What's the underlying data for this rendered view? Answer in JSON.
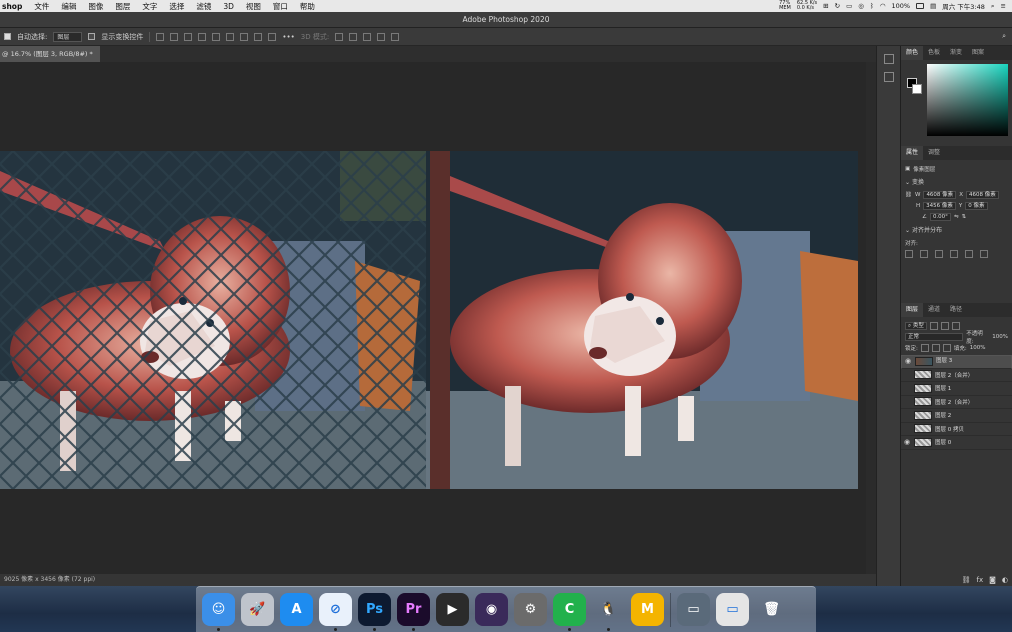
{
  "menubar": {
    "app": "shop",
    "items": [
      "文件",
      "编辑",
      "图像",
      "图层",
      "文字",
      "选择",
      "滤镜",
      "3D",
      "视图",
      "窗口",
      "帮助"
    ],
    "battery_pct": "77%",
    "cpu": "MEM",
    "net_up": "62.5 K/s",
    "net_down": "0.0 K/s",
    "battery": "100%",
    "clock": "周六 下午3:48"
  },
  "title": "Adobe Photoshop 2020",
  "options": {
    "auto_select": "自动选择:",
    "layer_select": "图层",
    "show_transform": "显示变换控件",
    "mode3d": "3D 模式:"
  },
  "doc_tab": "@ 16.7% (图层 3, RGB/8#) *",
  "status": "9025 像素 x 3456 像素 (72 ppi)",
  "panels": {
    "color_tabs": [
      "颜色",
      "色板",
      "渐变",
      "图案"
    ],
    "props_tabs": [
      "属性",
      "调整"
    ],
    "pixel_layer": "像素图层",
    "transform": "变换",
    "w": "4608 像素",
    "x": "4608 像素",
    "h": "3456 像素",
    "y": "0 像素",
    "angle": "0.00°",
    "align": "对齐并分布",
    "align_sub": "对齐:",
    "layer_tabs": [
      "图层",
      "通道",
      "路径"
    ],
    "kind": "类型",
    "blend": "正常",
    "opacity_label": "不透明度:",
    "opacity": "100%",
    "lock": "锁定:",
    "fill_label": "填充:",
    "fill": "100%",
    "layers": [
      {
        "name": "图层 3",
        "visible": true,
        "selected": true
      },
      {
        "name": "图层 2（合并）",
        "visible": false,
        "selected": false
      },
      {
        "name": "图层 1",
        "visible": false,
        "selected": false
      },
      {
        "name": "图层 2（合并）",
        "visible": false,
        "selected": false
      },
      {
        "name": "图层 2",
        "visible": false,
        "selected": false
      },
      {
        "name": "图层 0 拷贝",
        "visible": false,
        "selected": false
      },
      {
        "name": "图层 0",
        "visible": true,
        "selected": false
      }
    ]
  },
  "dock": [
    {
      "name": "Finder",
      "glyph": "☺",
      "bg": "#3b8fe8"
    },
    {
      "name": "Launchpad",
      "glyph": "🚀",
      "bg": "#bfc4cc"
    },
    {
      "name": "App Store",
      "glyph": "A",
      "bg": "#1e8cf0"
    },
    {
      "name": "Safari",
      "glyph": "⊘",
      "bg": "#e9f1fb"
    },
    {
      "name": "Photoshop",
      "glyph": "Ps",
      "bg": "#0d1a30"
    },
    {
      "name": "Premiere",
      "glyph": "Pr",
      "bg": "#1b0b2b"
    },
    {
      "name": "Final Cut",
      "glyph": "▶",
      "bg": "#2b2b2b"
    },
    {
      "name": "Motion",
      "glyph": "◉",
      "bg": "#3a2a5a"
    },
    {
      "name": "Compressor",
      "glyph": "⚙",
      "bg": "#6b6b6b"
    },
    {
      "name": "Camtasia",
      "glyph": "C",
      "bg": "#22b14c"
    },
    {
      "name": "QQ",
      "glyph": "🐧",
      "bg": "transparent"
    },
    {
      "name": "MindMaster",
      "glyph": "M",
      "bg": "#f4b400"
    },
    {
      "name": "Screenshot",
      "glyph": "▭",
      "bg": "#5a6a7a"
    },
    {
      "name": "Preview",
      "glyph": "▭",
      "bg": "#e5e5e5"
    },
    {
      "name": "Trash",
      "glyph": "🗑",
      "bg": "transparent"
    }
  ]
}
